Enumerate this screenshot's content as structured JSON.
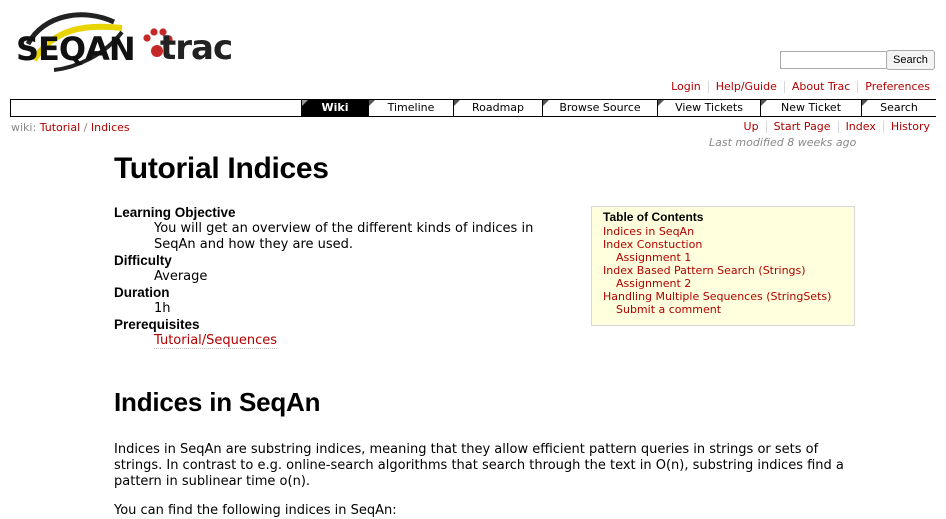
{
  "logo": {
    "left_text": "SEQAN",
    "right_text": "trac"
  },
  "search": {
    "value": "",
    "button_label": "Search"
  },
  "metanav": [
    "Login",
    "Help/Guide",
    "About Trac",
    "Preferences"
  ],
  "mainnav": [
    "Wiki",
    "Timeline",
    "Roadmap",
    "Browse Source",
    "View Tickets",
    "New Ticket",
    "Search"
  ],
  "breadcrumb": {
    "prefix": "wiki:",
    "part1": "Tutorial",
    "sep": "/",
    "part2": "Indices"
  },
  "ctxtnav": [
    "Up",
    "Start Page",
    "Index",
    "History"
  ],
  "lastmod": "Last modified 8 weeks ago",
  "page": {
    "title": "Tutorial Indices",
    "learning_objective_label": "Learning Objective",
    "learning_objective": "You will get an overview of the different kinds of indices in SeqAn and how they are used.",
    "difficulty_label": "Difficulty",
    "difficulty": "Average",
    "duration_label": "Duration",
    "duration": "1h",
    "prerequisites_label": "Prerequisites",
    "prerequisites": "Tutorial/Sequences",
    "section_heading": "Indices in SeqAn",
    "intro": "Indices in SeqAn are substring indices, meaning that they allow efficient pattern queries in strings or sets of strings. In contrast to e.g. online-search algorithms that search through the text in O(n), substring indices find a pattern in sublinear time o(n).",
    "next": "You can find the following indices in SeqAn:"
  },
  "toc": {
    "title": "Table of Contents",
    "items": [
      "Indices in SeqAn",
      "Index Constuction",
      "Assignment 1",
      "Index Based Pattern Search (Strings)",
      "Assignment 2",
      "Handling Multiple Sequences (StringSets)",
      "Submit a comment"
    ]
  },
  "colors": {
    "link": "#b00000",
    "toc_bg": "#ffffdd",
    "nav_active": "#000000"
  }
}
